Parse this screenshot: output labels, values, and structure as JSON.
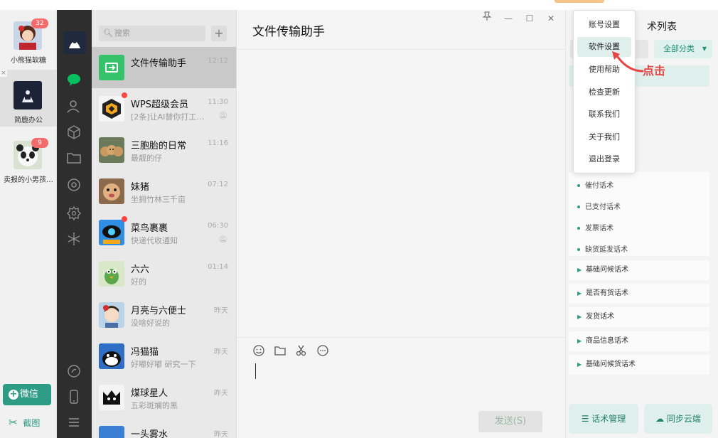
{
  "accounts": [
    {
      "name": "小熊猫软糖",
      "badge": "32"
    },
    {
      "name": "简鹿办公",
      "badge": ""
    },
    {
      "name": "卖报的小男孩…",
      "badge": "9"
    }
  ],
  "account_actions": {
    "wechat": "微信",
    "capture": "截图"
  },
  "chatlist": {
    "search_placeholder": "搜索",
    "chats": [
      {
        "name": "文件传输助手",
        "preview": "",
        "time": "12:12",
        "muted": false,
        "dot": false
      },
      {
        "name": "WPS超级会员",
        "preview": "[2条]让AI替你打工…",
        "time": "11:30",
        "muted": true,
        "dot": true
      },
      {
        "name": "三胞胎的日常",
        "preview": "最靓的仔",
        "time": "11:16",
        "muted": false,
        "dot": false
      },
      {
        "name": "妹猪",
        "preview": "坐拥竹林三千亩",
        "time": "07:12",
        "muted": false,
        "dot": false
      },
      {
        "name": "菜鸟裹裹",
        "preview": "快递代收通知",
        "time": "06:30",
        "muted": true,
        "dot": true
      },
      {
        "name": "六六",
        "preview": "好的",
        "time": "01:14",
        "muted": false,
        "dot": false
      },
      {
        "name": "月亮与六便士",
        "preview": "没啥好说的",
        "time": "昨天",
        "muted": false,
        "dot": false
      },
      {
        "name": "冯猫猫",
        "preview": "好嘟好嘟 研究一下",
        "time": "昨天",
        "muted": false,
        "dot": false
      },
      {
        "name": "煤球星人",
        "preview": "五彩斑斓的黑",
        "time": "昨天",
        "muted": false,
        "dot": false
      },
      {
        "name": "一头雾水",
        "preview": "",
        "time": "昨天",
        "muted": false,
        "dot": false
      }
    ]
  },
  "chat": {
    "title": "文件传输助手",
    "send_label": "发送(S)"
  },
  "right_panel": {
    "title": "术列表",
    "category_dropdown": "全部分类",
    "sub_items": [
      "催付话术",
      "已支付话术",
      "发票话术",
      "缺货延发话术"
    ],
    "categories": [
      "基础问候话术",
      "是否有货话术",
      "发货话术",
      "商品信息话术",
      "基础问候货话术"
    ],
    "manage_label": "话术管理",
    "sync_label": "同步云端"
  },
  "menu": {
    "items": [
      "账号设置",
      "软件设置",
      "使用帮助",
      "检查更新",
      "联系我们",
      "关于我们",
      "退出登录"
    ],
    "active_index": 1
  },
  "annotation": {
    "click_text": "点击"
  },
  "colors": {
    "accent": "#2e9b85",
    "wechat_green": "#07c160",
    "badge_red": "#f46b6b",
    "annotation_red": "#e64545"
  },
  "icons": {
    "window_pin": "pin-icon",
    "window_min": "minimize-icon",
    "window_max": "maximize-icon",
    "window_close": "close-icon"
  }
}
